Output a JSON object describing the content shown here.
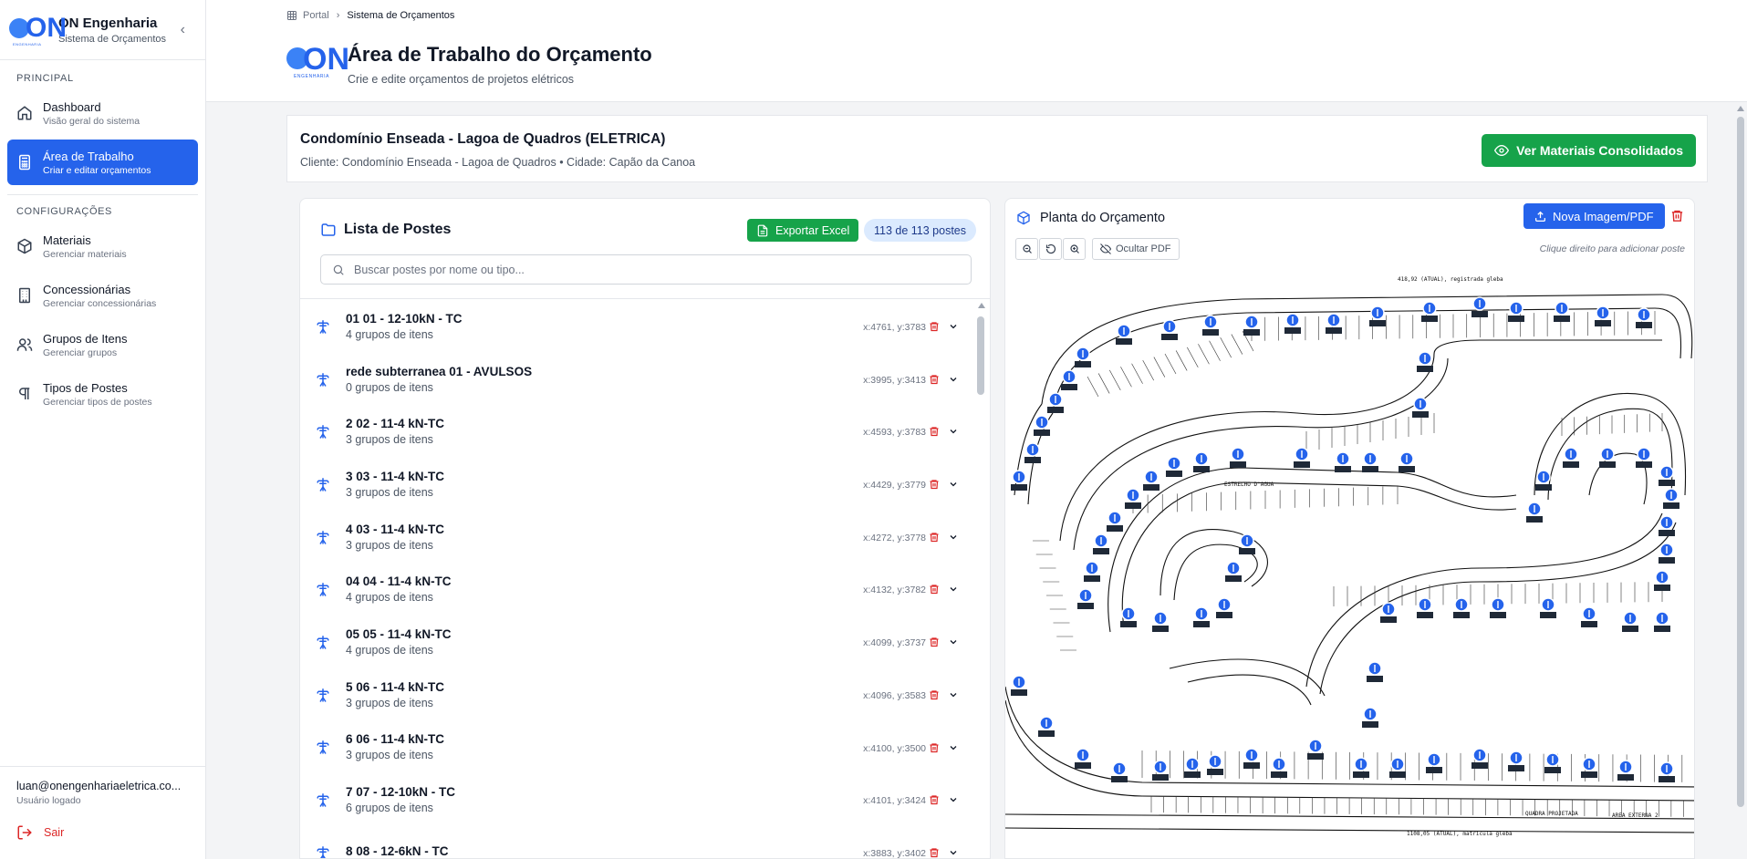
{
  "app": {
    "name": "ON Engenharia",
    "subtitle": "Sistema de Orçamentos",
    "logo_letters": "ON",
    "logo_sub": "ENGENHARIA"
  },
  "sidebar": {
    "sections": [
      {
        "label": "PRINCIPAL",
        "items": [
          {
            "title": "Dashboard",
            "desc": "Visão geral do sistema",
            "icon": "home-icon",
            "active": false
          },
          {
            "title": "Área de Trabalho",
            "desc": "Criar e editar orçamentos",
            "icon": "calculator-icon",
            "active": true
          }
        ]
      },
      {
        "label": "CONFIGURAÇÕES",
        "items": [
          {
            "title": "Materiais",
            "desc": "Gerenciar materiais",
            "icon": "package-icon",
            "active": false
          },
          {
            "title": "Concessionárias",
            "desc": "Gerenciar concessionárias",
            "icon": "building-icon",
            "active": false
          },
          {
            "title": "Grupos de Itens",
            "desc": "Gerenciar grupos",
            "icon": "users-icon",
            "active": false
          },
          {
            "title": "Tipos de Postes",
            "desc": "Gerenciar tipos de postes",
            "icon": "pilcrow-icon",
            "active": false
          }
        ]
      }
    ],
    "user": {
      "email": "luan@onengenhariaeletrica.co...",
      "status": "Usuário logado"
    },
    "logout_label": "Sair"
  },
  "header": {
    "breadcrumb_root": "Portal",
    "breadcrumb_current": "Sistema de Orçamentos",
    "title": "Área de Trabalho do Orçamento",
    "subtitle": "Crie e edite orçamentos de projetos elétricos"
  },
  "budget": {
    "title": "Condomínio Enseada - Lagoa de Quadros (ELETRICA)",
    "client_line": "Cliente: Condomínio Enseada - Lagoa de Quadros • Cidade: Capão da Canoa",
    "materials_button": "Ver Materiais Consolidados"
  },
  "poles": {
    "title": "Lista de Postes",
    "export_label": "Exportar Excel",
    "count_label": "113 de 113 postes",
    "search_placeholder": "Buscar postes por nome ou tipo...",
    "items": [
      {
        "name": "01 01 - 12-10kN - TC",
        "groups": "4 grupos de itens",
        "coords": "x:4761, y:3783"
      },
      {
        "name": "rede subterranea 01 - AVULSOS",
        "groups": "0 grupos de itens",
        "coords": "x:3995, y:3413"
      },
      {
        "name": "2 02 - 11-4 kN-TC",
        "groups": "3 grupos de itens",
        "coords": "x:4593, y:3783"
      },
      {
        "name": "3 03 - 11-4 kN-TC",
        "groups": "3 grupos de itens",
        "coords": "x:4429, y:3779"
      },
      {
        "name": "4 03 - 11-4 kN-TC",
        "groups": "3 grupos de itens",
        "coords": "x:4272, y:3778"
      },
      {
        "name": "04 04 - 11-4 kN-TC",
        "groups": "4 grupos de itens",
        "coords": "x:4132, y:3782"
      },
      {
        "name": "05 05 - 11-4 kN-TC",
        "groups": "4 grupos de itens",
        "coords": "x:4099, y:3737"
      },
      {
        "name": "5 06 - 11-4 kN-TC",
        "groups": "3 grupos de itens",
        "coords": "x:4096, y:3583"
      },
      {
        "name": "6 06 - 11-4 kN-TC",
        "groups": "3 grupos de itens",
        "coords": "x:4100, y:3500"
      },
      {
        "name": "7 07 - 12-10kN - TC",
        "groups": "6 grupos de itens",
        "coords": "x:4101, y:3424"
      },
      {
        "name": "8 08 - 12-6kN - TC",
        "groups": "",
        "coords": "x:3883, y:3402"
      }
    ]
  },
  "plan": {
    "title": "Planta do Orçamento",
    "new_image_label": "Nova Imagem/PDF",
    "hide_pdf_label": "Ocultar PDF",
    "hint": "Clique direito para adicionar poste",
    "accent": "#2563eb"
  },
  "colors": {
    "primary": "#2563eb",
    "success": "#16a34a",
    "danger": "#dc2626"
  }
}
